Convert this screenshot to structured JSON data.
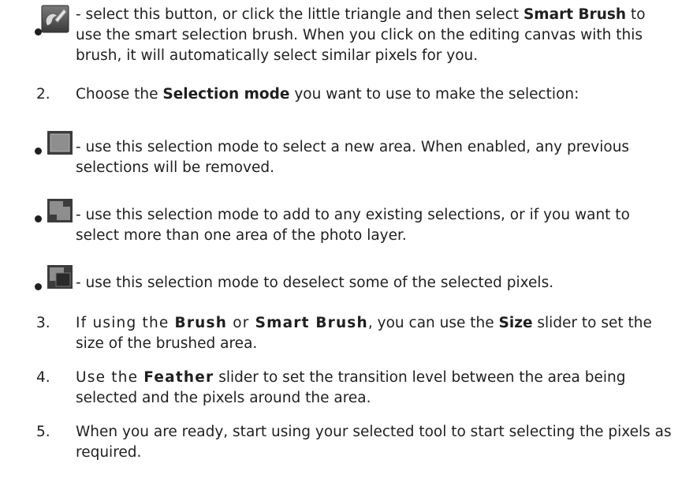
{
  "bullet_smart_brush": {
    "icon": "smart-brush-icon",
    "text_before": " - select this button, or click the little triangle and then select ",
    "bold": "Smart Brush",
    "text_after": " to use the smart selection brush. When you click on the editing canvas with this brush, it will automatically select similar pixels for you."
  },
  "step2": {
    "number": "2.",
    "text_before": "Choose the ",
    "bold": "Selection mode",
    "text_after": " you want to use to make the selection:"
  },
  "bullet_new": {
    "icon": "new-selection-icon",
    "text": " - use this selection mode to select a new area. When enabled, any previous selections will be removed."
  },
  "bullet_add": {
    "icon": "add-selection-icon",
    "text": " - use this selection mode to add to any existing selections, or if you want to select more than one area of the photo layer."
  },
  "bullet_subtract": {
    "icon": "subtract-selection-icon",
    "text": " - use this selection mode to deselect some of the selected pixels."
  },
  "step3": {
    "number": "3.",
    "text_a": "If using the ",
    "bold_a": "Brush",
    "text_b": " or ",
    "bold_b": "Smart Brush",
    "text_c": ", you can use the ",
    "bold_c": "Size",
    "text_d": " slider to set the size of the brushed area."
  },
  "step4": {
    "number": "4.",
    "text_a": "Use the ",
    "bold_a": "Feather",
    "text_b": " slider to set the transition level between the area being selected and the pixels around the area."
  },
  "step5": {
    "number": "5.",
    "text": "When you are ready, start using your selected tool to start selecting the pixels as required."
  }
}
